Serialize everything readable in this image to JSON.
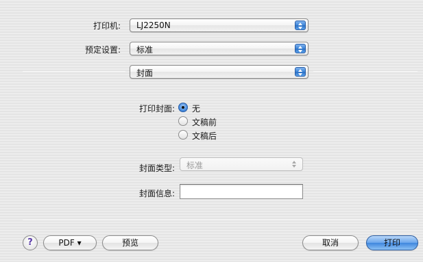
{
  "printer": {
    "label": "打印机:",
    "value": "LJ2250N",
    "icon": "stepper-arrows-icon"
  },
  "presets": {
    "label": "预定设置:",
    "value": "标准",
    "icon": "stepper-arrows-icon"
  },
  "panel": {
    "value": "封面",
    "icon": "stepper-arrows-icon"
  },
  "cover_page": {
    "label": "打印封面:",
    "options": [
      "无",
      "文稿前",
      "文稿后"
    ],
    "selected": "无"
  },
  "cover_type": {
    "label": "封面类型:",
    "value": "标准",
    "enabled": false
  },
  "cover_info": {
    "label": "封面信息:",
    "value": ""
  },
  "footer": {
    "help_label": "?",
    "pdf_label": "PDF ▾",
    "preview_label": "预览",
    "cancel_label": "取消",
    "print_label": "打印"
  },
  "colors": {
    "accent": "#3f87de",
    "help_glyph": "#5a3aa8"
  }
}
